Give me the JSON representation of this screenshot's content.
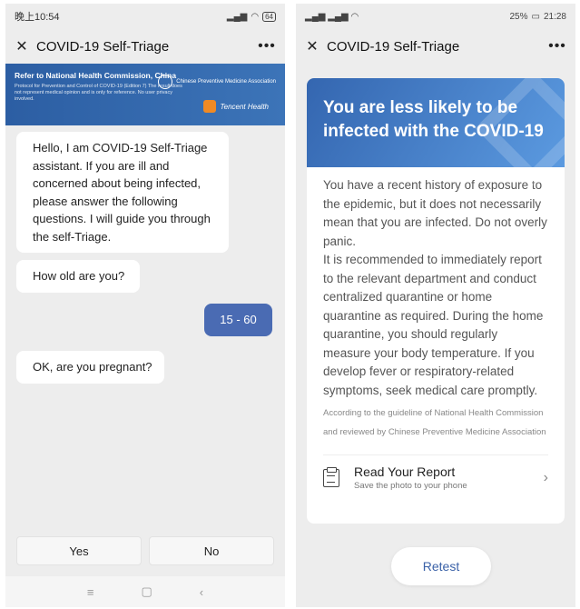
{
  "left": {
    "status": {
      "time": "晚上10:54",
      "battery": "64"
    },
    "title": "COVID-19 Self-Triage",
    "banner": {
      "title": "Refer to National Health Commission, China",
      "subtitle": "Protocol for Prevention and Control of COVID-19 (Edition 7) The result does not represent medical opinion and is only for reference. No user privacy involved.",
      "org1": "Chinese Preventive Medicine Association",
      "org2": "Tencent Health"
    },
    "messages": {
      "intro": "Hello, I am COVID-19 Self-Triage assistant. If you are ill and concerned about being infected, please answer the following questions. I will guide you through the self-Triage.",
      "age_question": "How old are you?",
      "age_answer": "15 - 60",
      "pregnant_question": "OK, are you pregnant?"
    },
    "answers": {
      "yes": "Yes",
      "no": "No"
    }
  },
  "right": {
    "status": {
      "battery_pct": "25%",
      "time": "21:28"
    },
    "title": "COVID-19 Self-Triage",
    "hero": "You are less likely to be infected with the COVID-19",
    "para1": "You have a recent history of exposure to the epidemic, but it does not necessarily mean that you are infected. Do not overly panic.",
    "para2": "It is recommended to immediately report to the relevant department and conduct centralized quarantine or home quarantine as required. During the home quarantine, you should regularly measure your body temperature. If you develop fever or respiratory-related symptoms, seek medical care promptly.",
    "source": "According to the guideline of National Health Commission and reviewed by Chinese Preventive Medicine Association",
    "report": {
      "title": "Read Your Report",
      "subtitle": "Save the photo to your phone"
    },
    "retest": "Retest"
  },
  "icons": {
    "close": "close-icon",
    "more": "more-icon",
    "chevron": "chevron-right-icon",
    "clipboard": "clipboard-icon"
  }
}
